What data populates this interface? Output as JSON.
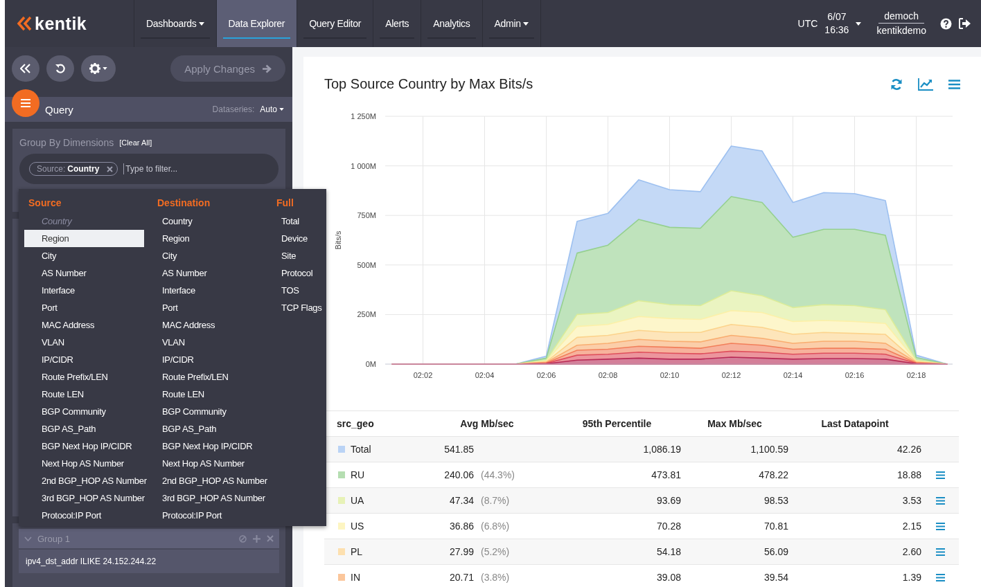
{
  "nav": {
    "logo": "kentik",
    "items": [
      {
        "label": "Dashboards",
        "dropdown": true,
        "selected": false
      },
      {
        "label": "Data Explorer",
        "dropdown": false,
        "selected": true
      },
      {
        "label": "Query Editor",
        "dropdown": false,
        "selected": false
      },
      {
        "label": "Alerts",
        "dropdown": false,
        "selected": false
      },
      {
        "label": "Analytics",
        "dropdown": false,
        "selected": false
      },
      {
        "label": "Admin",
        "dropdown": true,
        "selected": false
      }
    ],
    "timezone": "UTC",
    "date": "6/07",
    "time": "16:36",
    "user": "democh",
    "org": "kentikdemo"
  },
  "sidebar": {
    "apply_button": "Apply Changes",
    "query_title": "Query",
    "dataseries_label": "Dataseries:",
    "dataseries_value": "Auto",
    "group_by_title": "Group By Dimensions",
    "clear_all": "[Clear All]",
    "chip": {
      "prefix": "Source:",
      "value": "Country"
    },
    "filter_placeholder": "Type to filter...",
    "group": {
      "title": "Group 1",
      "expanded": true,
      "filter": "ipv4_dst_addr ILIKE 24.152.244.22"
    }
  },
  "dimension_menu": {
    "columns": [
      {
        "heading": "Source",
        "items": [
          {
            "label": "Country",
            "disabled": true,
            "selected": false
          },
          {
            "label": "Region",
            "disabled": false,
            "selected": true
          },
          {
            "label": "City",
            "disabled": false,
            "selected": false
          },
          {
            "label": "AS Number",
            "disabled": false,
            "selected": false
          },
          {
            "label": "Interface",
            "disabled": false,
            "selected": false
          },
          {
            "label": "Port",
            "disabled": false,
            "selected": false
          },
          {
            "label": "MAC Address",
            "disabled": false,
            "selected": false
          },
          {
            "label": "VLAN",
            "disabled": false,
            "selected": false
          },
          {
            "label": "IP/CIDR",
            "disabled": false,
            "selected": false
          },
          {
            "label": "Route Prefix/LEN",
            "disabled": false,
            "selected": false
          },
          {
            "label": "Route LEN",
            "disabled": false,
            "selected": false
          },
          {
            "label": "BGP Community",
            "disabled": false,
            "selected": false
          },
          {
            "label": "BGP AS_Path",
            "disabled": false,
            "selected": false
          },
          {
            "label": "BGP Next Hop IP/CIDR",
            "disabled": false,
            "selected": false
          },
          {
            "label": "Next Hop AS Number",
            "disabled": false,
            "selected": false
          },
          {
            "label": "2nd BGP_HOP AS Number",
            "disabled": false,
            "selected": false
          },
          {
            "label": "3rd BGP_HOP AS Number",
            "disabled": false,
            "selected": false
          },
          {
            "label": "Protocol:IP Port",
            "disabled": false,
            "selected": false
          }
        ]
      },
      {
        "heading": "Destination",
        "items": [
          {
            "label": "Country",
            "disabled": false,
            "selected": false
          },
          {
            "label": "Region",
            "disabled": false,
            "selected": false
          },
          {
            "label": "City",
            "disabled": false,
            "selected": false
          },
          {
            "label": "AS Number",
            "disabled": false,
            "selected": false
          },
          {
            "label": "Interface",
            "disabled": false,
            "selected": false
          },
          {
            "label": "Port",
            "disabled": false,
            "selected": false
          },
          {
            "label": "MAC Address",
            "disabled": false,
            "selected": false
          },
          {
            "label": "VLAN",
            "disabled": false,
            "selected": false
          },
          {
            "label": "IP/CIDR",
            "disabled": false,
            "selected": false
          },
          {
            "label": "Route Prefix/LEN",
            "disabled": false,
            "selected": false
          },
          {
            "label": "Route LEN",
            "disabled": false,
            "selected": false
          },
          {
            "label": "BGP Community",
            "disabled": false,
            "selected": false
          },
          {
            "label": "BGP AS_Path",
            "disabled": false,
            "selected": false
          },
          {
            "label": "BGP Next Hop IP/CIDR",
            "disabled": false,
            "selected": false
          },
          {
            "label": "Next Hop AS Number",
            "disabled": false,
            "selected": false
          },
          {
            "label": "2nd BGP_HOP AS Number",
            "disabled": false,
            "selected": false
          },
          {
            "label": "3rd BGP_HOP AS Number",
            "disabled": false,
            "selected": false
          },
          {
            "label": "Protocol:IP Port",
            "disabled": false,
            "selected": false
          }
        ]
      },
      {
        "heading": "Full",
        "items": [
          {
            "label": "Total",
            "disabled": false,
            "selected": false
          },
          {
            "label": "Device",
            "disabled": false,
            "selected": false
          },
          {
            "label": "Site",
            "disabled": false,
            "selected": false
          },
          {
            "label": "Protocol",
            "disabled": false,
            "selected": false
          },
          {
            "label": "TOS",
            "disabled": false,
            "selected": false
          },
          {
            "label": "TCP Flags",
            "disabled": false,
            "selected": false
          }
        ]
      }
    ]
  },
  "panel": {
    "title": "Top Source Country by Max Bits/s",
    "chart_data": {
      "type": "area",
      "stacked": false,
      "grid": true,
      "ylabel": "Bits/s",
      "categories": [
        null,
        "02:02",
        null,
        "02:04",
        null,
        "02:06",
        null,
        "02:08",
        null,
        "02:10",
        null,
        "02:12",
        null,
        "02:14",
        null,
        "02:16",
        null,
        "02:18",
        null
      ],
      "ylim": [
        0,
        1250
      ],
      "yticks": [
        {
          "value": 0,
          "label": "0M"
        },
        {
          "value": 250,
          "label": "250M"
        },
        {
          "value": 500,
          "label": "500M"
        },
        {
          "value": 750,
          "label": "750M"
        },
        {
          "value": 1000,
          "label": "1 000M"
        },
        {
          "value": 1250,
          "label": "1 250M"
        }
      ],
      "series": [
        {
          "name": "Total",
          "color": "#9dc0f0",
          "values": [
            0,
            0,
            0,
            0,
            0,
            40,
            720,
            760,
            930,
            880,
            870,
            1100,
            1075,
            815,
            865,
            860,
            825,
            45,
            0
          ]
        },
        {
          "name": "RU",
          "color": "#95d08f",
          "values": [
            0,
            0,
            0,
            0,
            0,
            30,
            560,
            600,
            730,
            690,
            685,
            845,
            815,
            640,
            680,
            680,
            650,
            33,
            0
          ]
        },
        {
          "name": "UA",
          "color": "#dcec98",
          "values": [
            0,
            0,
            0,
            0,
            0,
            20,
            250,
            260,
            320,
            300,
            295,
            370,
            345,
            285,
            300,
            295,
            275,
            20,
            0
          ]
        },
        {
          "name": "US",
          "color": "#fcf0a8",
          "values": [
            0,
            0,
            0,
            0,
            0,
            15,
            190,
            200,
            240,
            230,
            225,
            270,
            260,
            215,
            220,
            215,
            205,
            15,
            0
          ]
        },
        {
          "name": "PL",
          "color": "#fcd38c",
          "values": [
            0,
            0,
            0,
            0,
            0,
            12,
            135,
            145,
            170,
            160,
            160,
            200,
            185,
            150,
            160,
            155,
            150,
            12,
            0
          ]
        },
        {
          "name": "IN",
          "color": "#f9ad70",
          "values": [
            0,
            0,
            0,
            0,
            0,
            9,
            95,
            105,
            125,
            115,
            112,
            145,
            130,
            105,
            115,
            115,
            105,
            9,
            0
          ]
        },
        {
          "color": "#f27e5a",
          "values": [
            0,
            0,
            0,
            0,
            0,
            6,
            70,
            75,
            90,
            85,
            80,
            105,
            95,
            75,
            80,
            80,
            75,
            6,
            0
          ]
        },
        {
          "color": "#df4f5c",
          "values": [
            0,
            0,
            0,
            0,
            0,
            4,
            45,
            50,
            60,
            55,
            52,
            65,
            60,
            50,
            55,
            55,
            50,
            4,
            0
          ]
        },
        {
          "color": "#b82a55",
          "values": [
            0,
            0,
            0,
            0,
            0,
            2,
            20,
            25,
            30,
            25,
            25,
            35,
            30,
            25,
            28,
            28,
            25,
            2,
            0
          ]
        }
      ]
    },
    "table": {
      "columns": [
        "src_geo",
        "Avg Mb/sec",
        "95th Percentile",
        "Max Mb/sec",
        "Last Datapoint"
      ],
      "rows": [
        {
          "avg": "541.85",
          "p95": "1,086.19",
          "max": "1,100.59",
          "last": "42.26",
          "has_menu": false
        },
        {
          "avg": "240.06",
          "share": "(44.3%)",
          "p95": "473.81",
          "max": "478.22",
          "last": "18.88",
          "has_menu": true
        },
        {
          "avg": "47.34",
          "share": "(8.7%)",
          "p95": "93.69",
          "max": "98.53",
          "last": "3.53",
          "has_menu": true
        },
        {
          "avg": "36.86",
          "share": "(6.8%)",
          "p95": "70.28",
          "max": "70.81",
          "last": "2.15",
          "has_menu": true
        },
        {
          "avg": "27.99",
          "share": "(5.2%)",
          "p95": "54.18",
          "max": "56.09",
          "last": "2.60",
          "has_menu": true
        },
        {
          "avg": "20.71",
          "share": "(3.8%)",
          "p95": "39.08",
          "max": "39.54",
          "last": "1.39",
          "has_menu": true
        }
      ]
    }
  }
}
